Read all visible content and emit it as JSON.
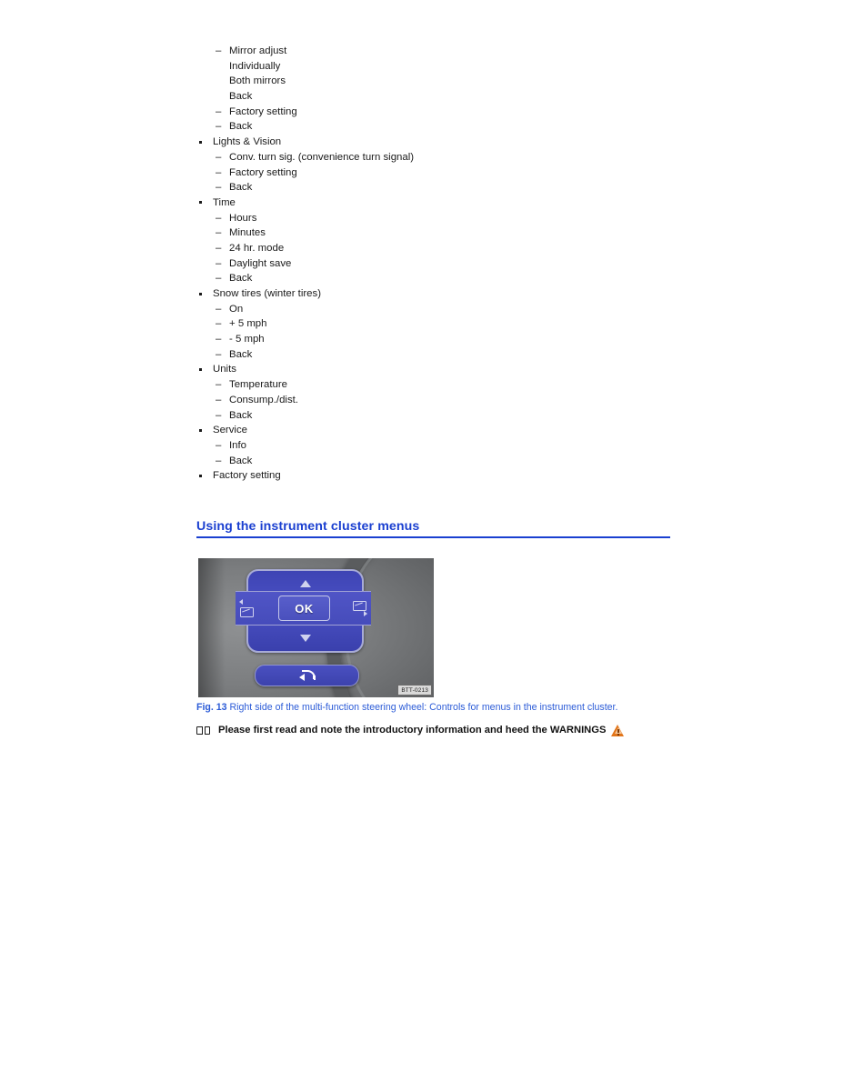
{
  "menu": {
    "items": [
      {
        "level": 2,
        "label": "Mirror adjust"
      },
      {
        "level": 3,
        "label": "Individually"
      },
      {
        "level": 3,
        "label": "Both mirrors"
      },
      {
        "level": 3,
        "label": "Back"
      },
      {
        "level": 2,
        "label": "Factory setting"
      },
      {
        "level": 2,
        "label": "Back"
      },
      {
        "level": 1,
        "label": "Lights & Vision"
      },
      {
        "level": 2,
        "label": "Conv. turn sig. (convenience turn signal)"
      },
      {
        "level": 2,
        "label": "Factory setting"
      },
      {
        "level": 2,
        "label": "Back"
      },
      {
        "level": 1,
        "label": "Time"
      },
      {
        "level": 2,
        "label": "Hours"
      },
      {
        "level": 2,
        "label": "Minutes"
      },
      {
        "level": 2,
        "label": "24 hr. mode"
      },
      {
        "level": 2,
        "label": "Daylight save"
      },
      {
        "level": 2,
        "label": "Back"
      },
      {
        "level": 1,
        "label": "Snow tires (winter tires)"
      },
      {
        "level": 2,
        "label": "On"
      },
      {
        "level": 2,
        "label": "+ 5 mph"
      },
      {
        "level": 2,
        "label": "- 5 mph"
      },
      {
        "level": 2,
        "label": "Back"
      },
      {
        "level": 1,
        "label": "Units"
      },
      {
        "level": 2,
        "label": "Temperature"
      },
      {
        "level": 2,
        "label": "Consump./dist."
      },
      {
        "level": 2,
        "label": "Back"
      },
      {
        "level": 1,
        "label": "Service"
      },
      {
        "level": 2,
        "label": "Info"
      },
      {
        "level": 2,
        "label": "Back"
      },
      {
        "level": 1,
        "label": "Factory setting"
      }
    ],
    "dash_marker": "–"
  },
  "heading": {
    "title": "Using the instrument cluster menus",
    "color": "#1a3fd0"
  },
  "figure": {
    "ok_label": "OK",
    "id_label": "BTT-0213",
    "caption_number": "Fig. 13",
    "caption_text": "Right side of the multi-function steering wheel: Controls for menus in the instrument cluster.",
    "caption_color": "#2b5bd7",
    "button_color": "#4a50c0"
  },
  "note": {
    "text": "Please first read and note the introductory information and heed the WARNINGS",
    "warning_color": "#e2761b"
  }
}
